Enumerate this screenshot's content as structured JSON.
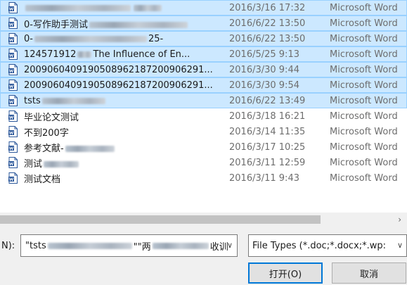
{
  "files": [
    {
      "name_prefix": "",
      "name_suffix": "",
      "date": "2016/3/16 17:32",
      "type": "Microsoft Word",
      "selected": true,
      "blur_widths": [
        150,
        40
      ]
    },
    {
      "name_prefix": "0-写作助手测试",
      "name_suffix": "",
      "date": "2016/6/22 13:50",
      "type": "Microsoft Word",
      "selected": true,
      "blur_widths": [
        140
      ]
    },
    {
      "name_prefix": "0-",
      "name_suffix": "25-",
      "date": "2016/6/22 13:50",
      "type": "Microsoft Word",
      "selected": true,
      "blur_widths": [
        160
      ]
    },
    {
      "name_prefix": "124571912",
      "name_suffix": "The Influence of En...",
      "date": "2016/5/25 9:13",
      "type": "Microsoft Word",
      "selected": true,
      "blur_widths": [
        20
      ]
    },
    {
      "name_prefix": "20090604091905089621872009062​91...",
      "name_suffix": "",
      "date": "2016/3/30 9:44",
      "type": "Microsoft Word",
      "selected": true,
      "blur_widths": []
    },
    {
      "name_prefix": "2009060409190508962187200906291...",
      "name_suffix": "",
      "date": "2016/3/30 9:54",
      "type": "Microsoft Word",
      "selected": true,
      "blur_widths": []
    },
    {
      "name_prefix": "tsts",
      "name_suffix": "",
      "date": "2016/6/22 13:49",
      "type": "Microsoft Word",
      "selected": true,
      "blur_widths": [
        90
      ]
    },
    {
      "name_prefix": "毕业论文测试",
      "name_suffix": "",
      "date": "2016/3/18 16:21",
      "type": "Microsoft Word",
      "selected": false,
      "blur_widths": []
    },
    {
      "name_prefix": "不到200字",
      "name_suffix": "",
      "date": "2016/3/14 11:35",
      "type": "Microsoft Word",
      "selected": false,
      "blur_widths": []
    },
    {
      "name_prefix": "参考文献-",
      "name_suffix": "",
      "date": "2016/3/17 10:25",
      "type": "Microsoft Word",
      "selected": false,
      "blur_widths": [
        70
      ]
    },
    {
      "name_prefix": "测试",
      "name_suffix": "",
      "date": "2016/3/11 12:59",
      "type": "Microsoft Word",
      "selected": false,
      "blur_widths": [
        50
      ]
    },
    {
      "name_prefix": "测试文档",
      "name_suffix": "",
      "date": "2016/3/11 9:43",
      "type": "Microsoft Word",
      "selected": false,
      "blur_widths": []
    }
  ],
  "scrollbar": {
    "arrow": "›"
  },
  "filename": {
    "label": "N):",
    "value_start": "\"tsts",
    "value_mid": "\"\"两",
    "value_end": "收​训",
    "arrow": "∨"
  },
  "filetype": {
    "value": "File Types (*.doc;*.docx;*.wp:",
    "arrow": "∨"
  },
  "buttons": {
    "open": "打开(O)",
    "cancel": "取消"
  },
  "colors": {
    "selected_bg": "#cce8ff",
    "accent": "#0078d7",
    "word_blue": "#2b579a"
  },
  "icons": {
    "file": "word-doc-icon"
  }
}
